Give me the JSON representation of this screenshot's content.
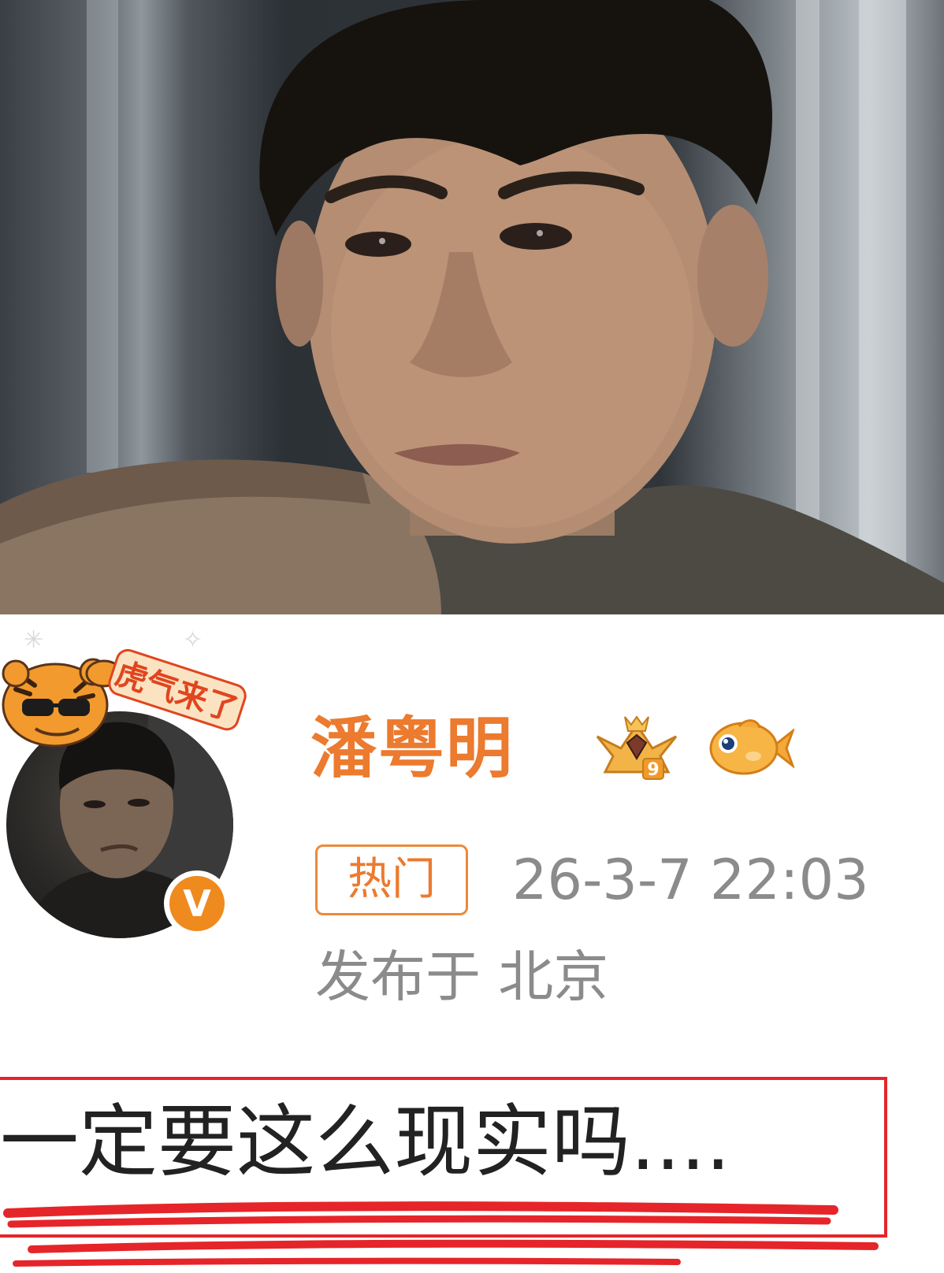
{
  "post": {
    "username": "潘粤明",
    "avatar_frame_text": "虎气来了",
    "verified_mark": "V",
    "hot_tag": "热门",
    "timestamp": "26-3-7 22:03",
    "location": "发布于 北京",
    "content": "一定要这么现实吗....",
    "badges": [
      "crown-level-9-icon",
      "goldfish-icon"
    ],
    "crown_level": "9"
  },
  "colors": {
    "username": "#ec7a2f",
    "meta_text": "#8b8b8b",
    "highlight_box": "#e5252a",
    "verified_badge": "#ef8a1e"
  }
}
